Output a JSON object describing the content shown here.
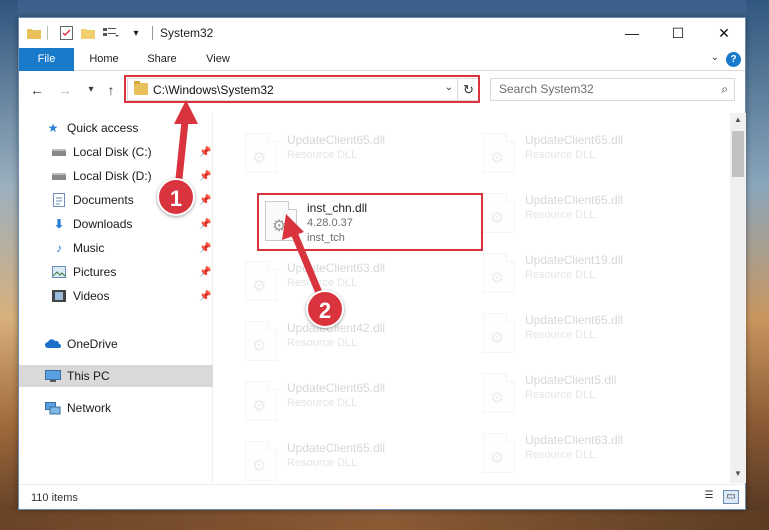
{
  "window": {
    "title": "System32",
    "quick_access_dropdown": "▾",
    "minimize": "—",
    "maximize": "☐",
    "close": "✕"
  },
  "ribbon": {
    "tabs": [
      {
        "label": "File"
      },
      {
        "label": "Home"
      },
      {
        "label": "Share"
      },
      {
        "label": "View"
      }
    ]
  },
  "navigation": {
    "back": "←",
    "forward": "→",
    "recent": "▾",
    "up": "↑",
    "address_path": "C:\\Windows\\System32",
    "search_placeholder": "Search System32"
  },
  "sidebar": {
    "items": [
      {
        "label": "Quick access",
        "icon": "star-icon",
        "pinned": false
      },
      {
        "label": "Local Disk (C:)",
        "icon": "drive-icon",
        "pinned": true
      },
      {
        "label": "Local Disk (D:)",
        "icon": "drive-icon",
        "pinned": true
      },
      {
        "label": "Documents",
        "icon": "documents-icon",
        "pinned": true
      },
      {
        "label": "Downloads",
        "icon": "download-icon",
        "pinned": true
      },
      {
        "label": "Music",
        "icon": "music-icon",
        "pinned": true
      },
      {
        "label": "Pictures",
        "icon": "pictures-icon",
        "pinned": true
      },
      {
        "label": "Videos",
        "icon": "videos-icon",
        "pinned": true
      },
      {
        "label": "OneDrive",
        "icon": "cloud-icon",
        "pinned": false
      },
      {
        "label": "This PC",
        "icon": "computer-icon",
        "pinned": false,
        "selected": true
      },
      {
        "label": "Network",
        "icon": "network-icon",
        "pinned": false
      }
    ]
  },
  "files": {
    "left_column": [
      {
        "name": "UpdateClient65.dll",
        "line2": "Resource DLL",
        "highlighted": false
      },
      {
        "name": "inst_chn.dll",
        "line2": "4.28.0.37",
        "line3": "inst_tch",
        "highlighted": true
      },
      {
        "name": "UpdateClient63.dll",
        "line2": "Resource DLL",
        "highlighted": false
      },
      {
        "name": "UpdateClient42.dll",
        "line2": "Resource DLL",
        "highlighted": false
      },
      {
        "name": "UpdateClient65.dll",
        "line2": "Resource DLL",
        "highlighted": false
      },
      {
        "name": "UpdateClient65.dll",
        "line2": "Resource DLL",
        "highlighted": false
      }
    ],
    "right_column": [
      {
        "name": "UpdateClient65.dll",
        "line2": "Resource DLL"
      },
      {
        "name": "UpdateClient65.dll",
        "line2": "Resource DLL"
      },
      {
        "name": "UpdateClient19.dll",
        "line2": "Resource DLL"
      },
      {
        "name": "UpdateClient65.dll",
        "line2": "Resource DLL"
      },
      {
        "name": "UpdateClient5.dll",
        "line2": "Resource DLL"
      },
      {
        "name": "UpdateClient63.dll",
        "line2": "Resource DLL"
      }
    ]
  },
  "status": {
    "item_count": "110 items"
  },
  "annotations": {
    "callout_1": "1",
    "callout_2": "2",
    "color": "#d9343d"
  }
}
